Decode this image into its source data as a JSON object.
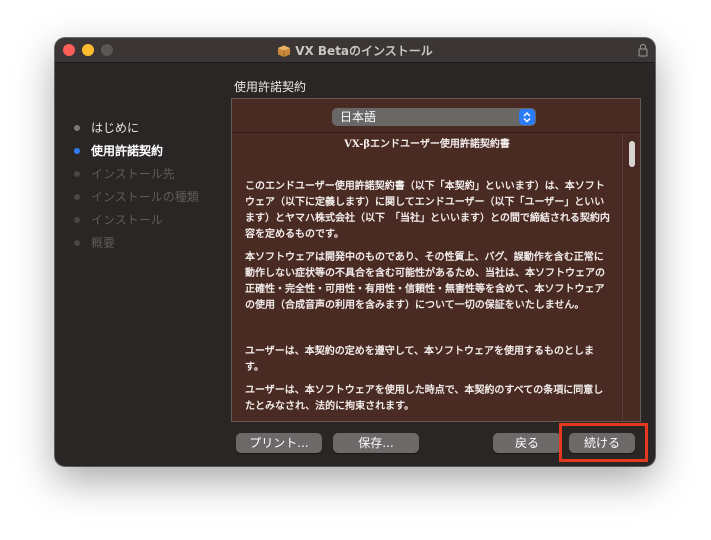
{
  "window": {
    "title": "VX Betaのインストール"
  },
  "section_heading": "使用許諾契約",
  "sidebar": {
    "steps": [
      {
        "label": "はじめに",
        "state": "done"
      },
      {
        "label": "使用許諾契約",
        "state": "current"
      },
      {
        "label": "インストール先",
        "state": "future"
      },
      {
        "label": "インストールの種類",
        "state": "future"
      },
      {
        "label": "インストール",
        "state": "future"
      },
      {
        "label": "概要",
        "state": "future"
      }
    ]
  },
  "language_select": {
    "value": "日本語"
  },
  "document": {
    "title": "VX-βエンドユーザー使用許諾契約書",
    "paragraphs": [
      "このエンドユーザー使用許諾契約書（以下「本契約」といいます）は、本ソフトウェア（以下に定義します）に関してエンドユーザー（以下「ユーザー」といいます）とヤマハ株式会社（以下　「当社」といいます）との間で締結される契約内容を定めるものです。",
      "本ソフトウェアは開発中のものであり、その性質上、バグ、誤動作を含む正常に動作しない症状等の不具合を含む可能性があるため、当社は、本ソフトウェアの正確性・完全性・可用性・有用性・信頼性・無害性等を含めて、本ソフトウェアの使用（合成音声の利用を含みます）について一切の保証をいたしません。",
      "ユーザーは、本契約の定めを遵守して、本ソフトウェアを使用するものとします。",
      "ユーザーは、本ソフトウェアを使用した時点で、本契約のすべての条項に同意したとみなされ、法的に拘束されます。"
    ]
  },
  "buttons": {
    "print": "プリント...",
    "save": "保存...",
    "back": "戻る",
    "continue": "続ける"
  },
  "colors": {
    "window_bg": "#2a2625",
    "document_bg": "#4a2b24",
    "current_step_dot": "#2f7cf6",
    "highlight": "#e4391c"
  },
  "icons": {
    "title": "package-icon",
    "lock": "lock-icon",
    "select": "chevron-updown-icon"
  }
}
